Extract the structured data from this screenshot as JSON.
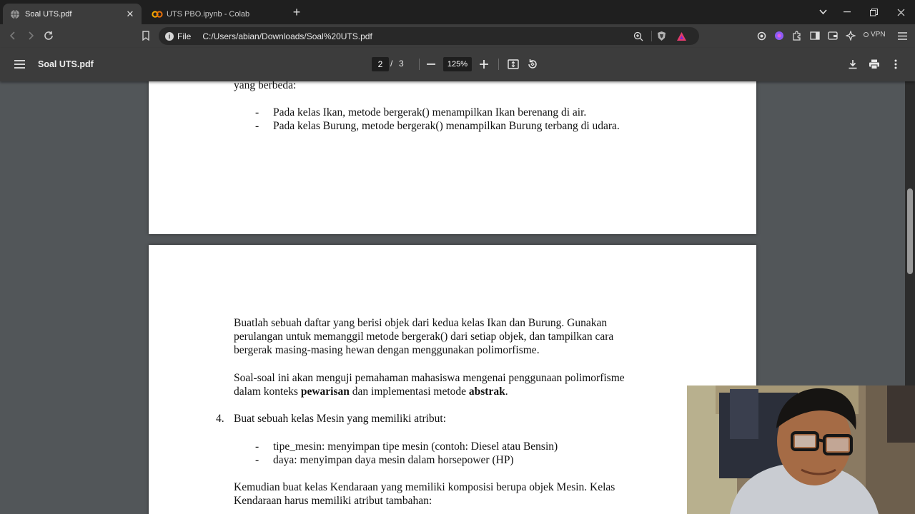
{
  "tabs": [
    {
      "title": "Soal UTS.pdf",
      "active": true
    },
    {
      "title": "UTS PBO.ipynb - Colab",
      "active": false
    }
  ],
  "address": {
    "scheme_label": "File",
    "url": "C:/Users/abian/Downloads/Soal%20UTS.pdf",
    "vpn_label": "VPN"
  },
  "pdf_toolbar": {
    "file_name": "Soal UTS.pdf",
    "current_page": "2",
    "page_separator": "/",
    "total_pages": "3",
    "zoom": "125%"
  },
  "document": {
    "page1": {
      "intro_tail": "yang berbeda:",
      "bullets": [
        "Pada kelas Ikan, metode bergerak() menampilkan Ikan berenang di air.",
        "Pada kelas Burung, metode bergerak() menampilkan Burung terbang di udara."
      ]
    },
    "page2": {
      "para1_lines": [
        "Buatlah sebuah daftar yang berisi objek dari kedua kelas Ikan dan Burung. Gunakan",
        "perulangan untuk memanggil metode bergerak() dari setiap objek, dan tampilkan cara",
        "bergerak masing-masing hewan dengan menggunakan polimorfisme."
      ],
      "para2_line1": "Soal-soal ini akan menguji pemahaman mahasiswa mengenai penggunaan polimorfisme",
      "para2_line2_a": "dalam konteks ",
      "para2_line2_b": "pewarisan",
      "para2_line2_c": " dan implementasi metode ",
      "para2_line2_d": "abstrak",
      "para2_line2_e": ".",
      "q4_number": "4.",
      "q4_text": "Buat sebuah kelas Mesin yang memiliki atribut:",
      "q4_bullets": [
        "tipe_mesin: menyimpan tipe mesin (contoh: Diesel atau Bensin)",
        "daya: menyimpan daya mesin dalam horsepower (HP)"
      ],
      "para3_lines": [
        "Kemudian buat kelas Kendaraan yang memiliki komposisi berupa objek Mesin. Kelas",
        "Kendaraan harus memiliki atribut tambahan:"
      ],
      "bullet_char": "-"
    }
  }
}
